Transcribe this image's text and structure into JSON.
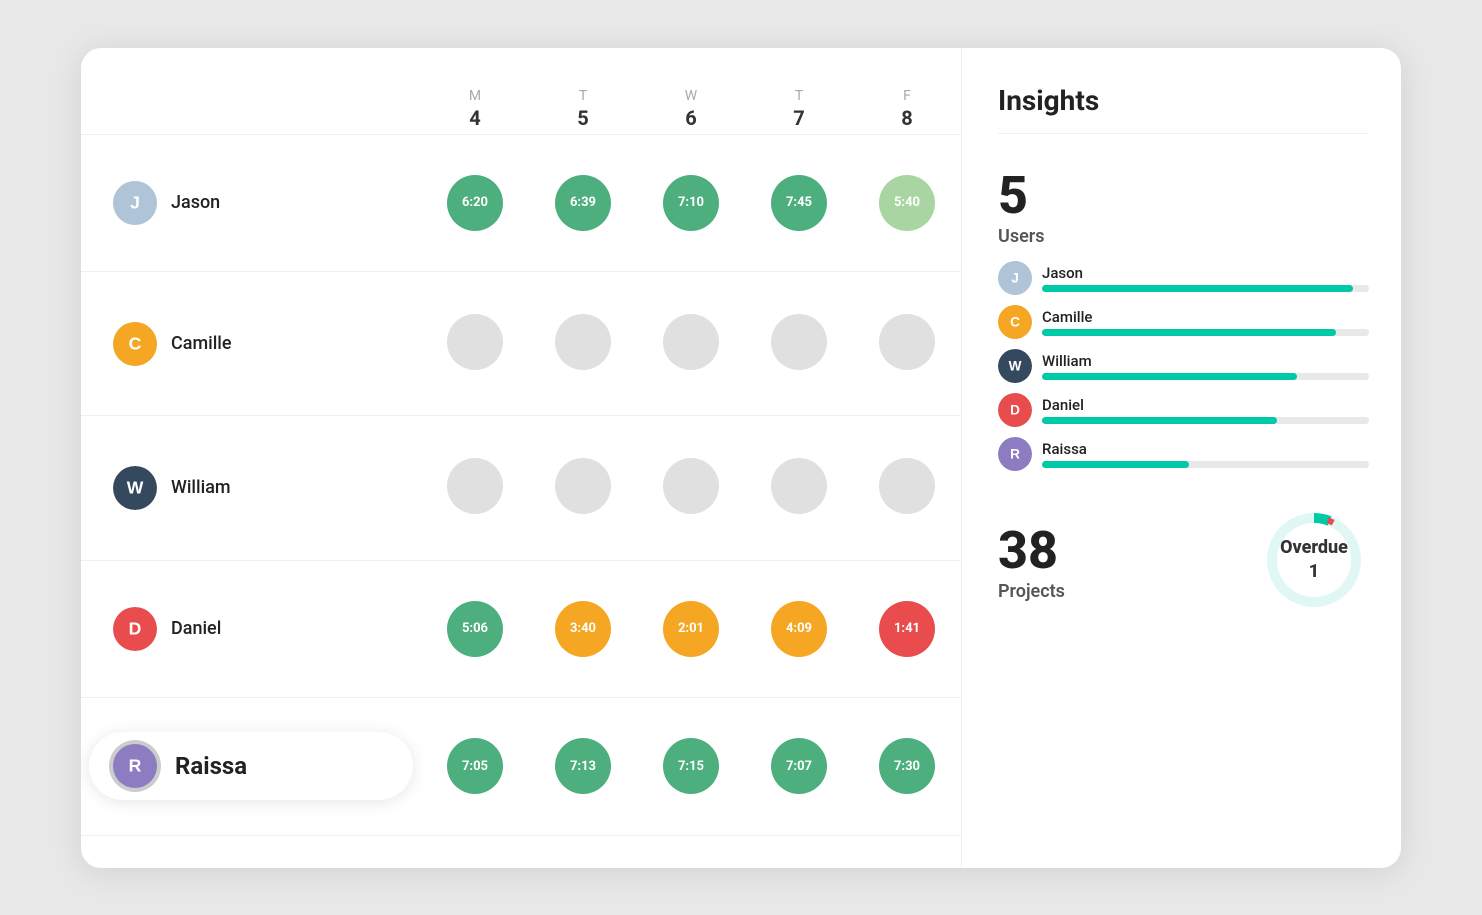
{
  "insights": {
    "title": "Insights",
    "users_count": "5",
    "users_label": "Users",
    "projects_count": "38",
    "projects_label": "Projects",
    "overdue_label": "Overdue",
    "overdue_count": "1"
  },
  "days": [
    {
      "letter": "M",
      "num": "4"
    },
    {
      "letter": "T",
      "num": "5"
    },
    {
      "letter": "W",
      "num": "6"
    },
    {
      "letter": "T",
      "num": "7"
    },
    {
      "letter": "F",
      "num": "8"
    }
  ],
  "users": [
    {
      "name": "Jason",
      "selected": false,
      "times": [
        "6:20",
        "6:39",
        "7:10",
        "7:45",
        "5:40"
      ],
      "colors": [
        "green",
        "green",
        "green",
        "green",
        "light-green"
      ],
      "bar_pct": 95
    },
    {
      "name": "Camille",
      "selected": false,
      "times": [
        "",
        "",
        "",
        "",
        ""
      ],
      "colors": [
        "empty",
        "empty",
        "empty",
        "empty",
        "empty"
      ],
      "bar_pct": 90
    },
    {
      "name": "William",
      "selected": false,
      "times": [
        "",
        "",
        "",
        "",
        ""
      ],
      "colors": [
        "empty",
        "empty",
        "empty",
        "empty",
        "empty"
      ],
      "bar_pct": 78
    },
    {
      "name": "Daniel",
      "selected": false,
      "times": [
        "5:06",
        "3:40",
        "2:01",
        "4:09",
        "1:41"
      ],
      "colors": [
        "green",
        "yellow",
        "yellow",
        "yellow",
        "red"
      ],
      "bar_pct": 72
    },
    {
      "name": "Raissa",
      "selected": true,
      "times": [
        "7:05",
        "7:13",
        "7:15",
        "7:07",
        "7:30"
      ],
      "colors": [
        "green",
        "green",
        "green",
        "green",
        "green"
      ],
      "bar_pct": 45
    }
  ],
  "avatars": {
    "Jason": {
      "bg": "#b0c4d8",
      "label": "J"
    },
    "Camille": {
      "bg": "#f5a623",
      "label": "C"
    },
    "William": {
      "bg": "#34495e",
      "label": "W"
    },
    "Daniel": {
      "bg": "#e84c4c",
      "label": "D"
    },
    "Raissa": {
      "bg": "#8e7cc3",
      "label": "R"
    }
  }
}
